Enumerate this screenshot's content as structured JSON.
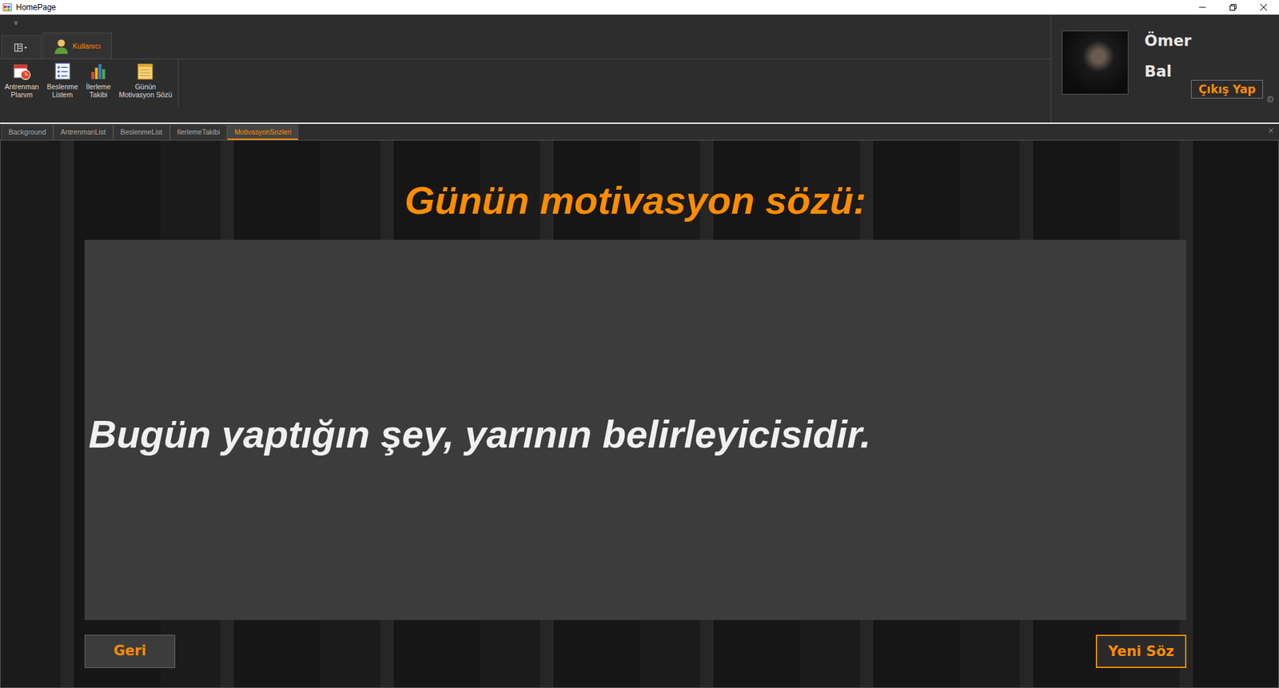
{
  "window": {
    "title": "HomePage"
  },
  "ribbon": {
    "tabs": [
      {
        "label": "Kullanıcı",
        "selected": true
      }
    ],
    "buttons": [
      {
        "lines": [
          "Antrenman",
          "Planım"
        ],
        "kind": "calendar"
      },
      {
        "lines": [
          "Beslenme",
          "Listem"
        ],
        "kind": "list"
      },
      {
        "lines": [
          "İlerleme",
          "Takibi"
        ],
        "kind": "chart"
      },
      {
        "lines": [
          "Günün",
          "Motivasyon Sözü"
        ],
        "kind": "note"
      }
    ]
  },
  "user": {
    "first_name": "Ömer",
    "last_name": "Bal",
    "logout": "Çıkış Yap"
  },
  "doc_tabs": [
    {
      "label": "Background",
      "selected": false
    },
    {
      "label": "AntrenmanList",
      "selected": false
    },
    {
      "label": "BeslenmeList",
      "selected": false
    },
    {
      "label": "IlerlemeTakibi",
      "selected": false
    },
    {
      "label": "MotivasyonSozleri",
      "selected": true
    }
  ],
  "page": {
    "heading": "Günün motivasyon sözü:",
    "quote": "Bugün yaptığın şey, yarının belirleyicisidir.",
    "back": "Geri",
    "next": "Yeni Söz"
  }
}
